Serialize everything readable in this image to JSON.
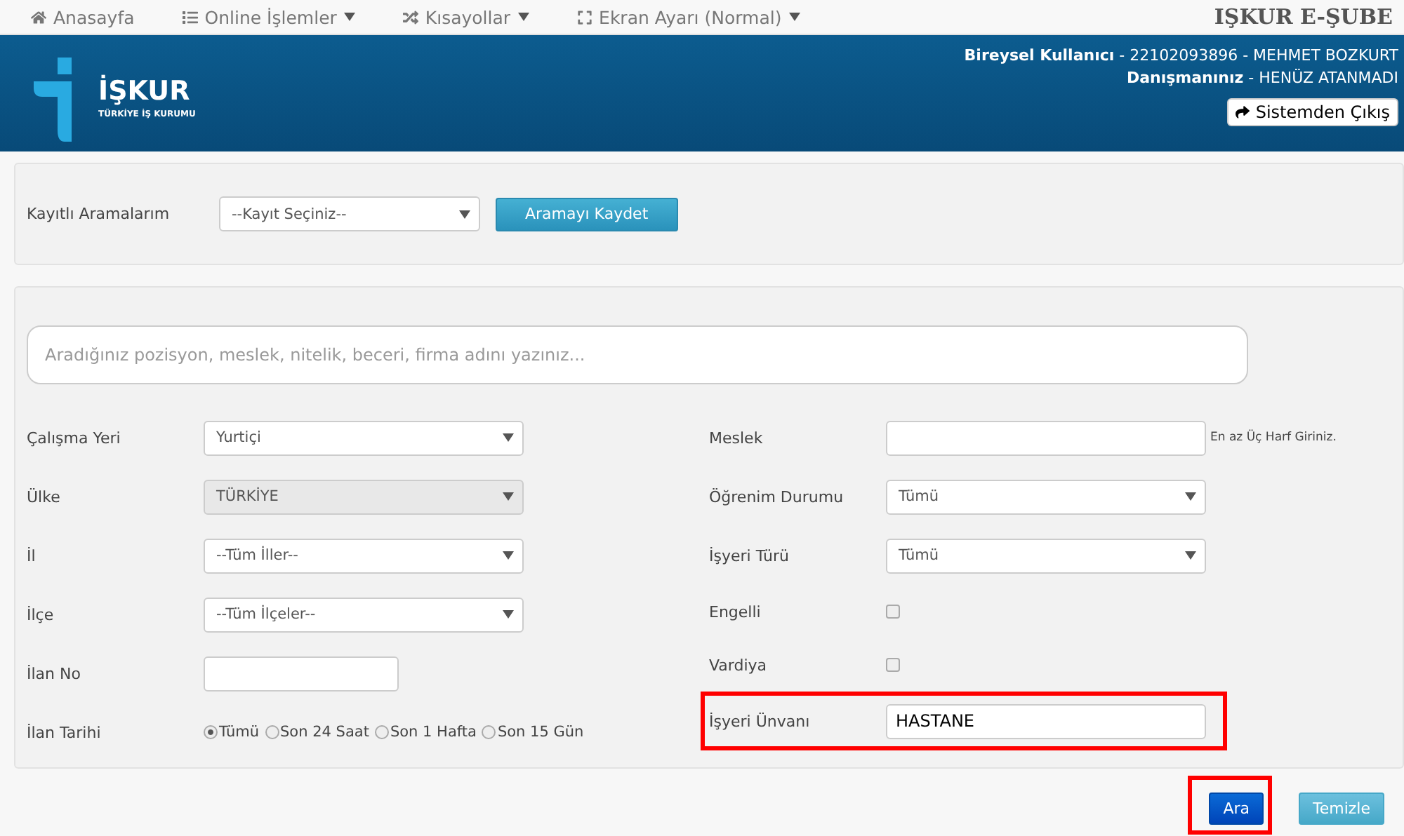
{
  "nav": {
    "items": [
      {
        "label": "Anasayfa",
        "dropdown": false
      },
      {
        "label": "Online İşlemler",
        "dropdown": true
      },
      {
        "label": "Kısayollar",
        "dropdown": true
      },
      {
        "label": "Ekran Ayarı (Normal)",
        "dropdown": true
      }
    ],
    "brand": "IŞKUR E-ŞUBE"
  },
  "header": {
    "logo_name": "İŞKUR",
    "logo_sub": "TÜRKİYE İŞ KURUMU",
    "user_label": "Bireysel Kullanıcı",
    "user_value": " - 22102093896 - MEHMET BOZKURT",
    "advisor_label": "Danışmanınız",
    "advisor_value": " - HENÜZ ATANMADI",
    "logout": "Sistemden Çıkış"
  },
  "saved": {
    "label": "Kayıtlı Aramalarım",
    "select": "--Kayıt Seçiniz--",
    "button": "Aramayı Kaydet"
  },
  "search": {
    "placeholder": "Aradığınız pozisyon, meslek, nitelik, beceri, firma adını yazınız..."
  },
  "left_fields": [
    {
      "label": "Çalışma Yeri",
      "kind": "select",
      "value": "Yurtiçi",
      "disabled": false
    },
    {
      "label": "Ülke",
      "kind": "select",
      "value": "TÜRKİYE",
      "disabled": true
    },
    {
      "label": "İl",
      "kind": "select",
      "value": "--Tüm İller--",
      "disabled": false
    },
    {
      "label": "İlçe",
      "kind": "select",
      "value": "--Tüm İlçeler--",
      "disabled": false
    },
    {
      "label": "İlan No",
      "kind": "input"
    },
    {
      "label": "İlan Tarihi",
      "kind": "radios",
      "options": [
        {
          "label": "Tümü",
          "selected": true
        },
        {
          "label": "Son 24 Saat",
          "selected": false
        },
        {
          "label": "Son 1 Hafta",
          "selected": false
        },
        {
          "label": "Son 15 Gün",
          "selected": false
        }
      ]
    }
  ],
  "right_fields": [
    {
      "label": "Meslek",
      "kind": "input",
      "hint": "En az Üç Harf Giriniz.",
      "highlighted": false
    },
    {
      "label": "Öğrenim Durumu",
      "kind": "select",
      "value": "Tümü",
      "highlighted": false
    },
    {
      "label": "İşyeri Türü",
      "kind": "select",
      "value": "Tümü",
      "highlighted": false
    },
    {
      "label": "Engelli",
      "kind": "checkbox",
      "checked": false,
      "highlighted": false
    },
    {
      "label": "Vardiya",
      "kind": "checkbox",
      "checked": false,
      "highlighted": false
    },
    {
      "label": "İşyeri Ünvanı",
      "kind": "input",
      "value": "HASTANE",
      "highlighted": true
    }
  ],
  "actions": [
    {
      "label": "Ara",
      "kind": "primary",
      "highlighted": true
    },
    {
      "label": "Temizle",
      "kind": "info",
      "highlighted": false
    }
  ]
}
